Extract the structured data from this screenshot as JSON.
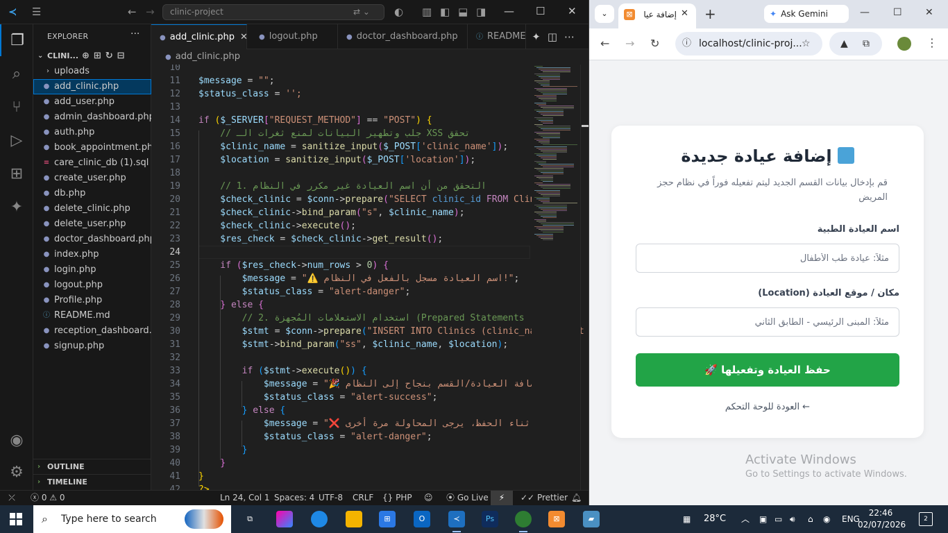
{
  "vscode": {
    "command_center": "clinic-project",
    "explorer_title": "EXPLORER",
    "project_name": "CLINI...",
    "files": [
      {
        "name": "uploads",
        "kind": "folder"
      },
      {
        "name": "add_clinic.php",
        "kind": "php",
        "selected": true
      },
      {
        "name": "add_user.php",
        "kind": "php"
      },
      {
        "name": "admin_dashboard.php",
        "kind": "php"
      },
      {
        "name": "auth.php",
        "kind": "php"
      },
      {
        "name": "book_appointment.php",
        "kind": "php"
      },
      {
        "name": "care_clinic_db (1).sql",
        "kind": "db"
      },
      {
        "name": "create_user.php",
        "kind": "php"
      },
      {
        "name": "db.php",
        "kind": "php"
      },
      {
        "name": "delete_clinic.php",
        "kind": "php"
      },
      {
        "name": "delete_user.php",
        "kind": "php"
      },
      {
        "name": "doctor_dashboard.php",
        "kind": "php"
      },
      {
        "name": "index.php",
        "kind": "php"
      },
      {
        "name": "login.php",
        "kind": "php"
      },
      {
        "name": "logout.php",
        "kind": "php"
      },
      {
        "name": "Profile.php",
        "kind": "php"
      },
      {
        "name": "README.md",
        "kind": "md"
      },
      {
        "name": "reception_dashboard....",
        "kind": "php"
      },
      {
        "name": "signup.php",
        "kind": "php"
      }
    ],
    "outline_label": "OUTLINE",
    "timeline_label": "TIMELINE",
    "tabs": [
      {
        "label": "add_clinic.php",
        "active": true
      },
      {
        "label": "logout.php",
        "active": false
      },
      {
        "label": "doctor_dashboard.php",
        "active": false
      },
      {
        "label": "README",
        "active": false
      }
    ],
    "breadcrumb": "add_clinic.php",
    "line_numbers": [
      "10",
      "11",
      "12",
      "13",
      "14",
      "15",
      "16",
      "17",
      "18",
      "19",
      "20",
      "21",
      "22",
      "23",
      "24",
      "25",
      "26",
      "27",
      "28",
      "29",
      "30",
      "31",
      "32",
      "33",
      "34",
      "35",
      "36",
      "37",
      "38",
      "39",
      "40",
      "41",
      "42"
    ],
    "current_line": "24",
    "code_lines": [
      [],
      [
        [
          "v",
          "$message"
        ],
        [
          "p",
          " = "
        ],
        [
          "s",
          "\"\""
        ],
        [
          "p",
          ";"
        ]
      ],
      [
        [
          "v",
          "$status_class"
        ],
        [
          "p",
          " = "
        ],
        [
          "s",
          "'';"
        ]
      ],
      [],
      [
        [
          "k",
          "if "
        ],
        [
          "b1",
          "("
        ],
        [
          "v",
          "$_SERVER"
        ],
        [
          "b2",
          "["
        ],
        [
          "s",
          "\"REQUEST_METHOD\""
        ],
        [
          "b2",
          "]"
        ],
        [
          "p",
          " == "
        ],
        [
          "s",
          "\"POST\""
        ],
        [
          "b1",
          ")"
        ],
        [
          "p",
          " "
        ],
        [
          "b1",
          "{"
        ]
      ],
      [
        [
          "c",
          "    // جلب وتطهير البيانات لمنع ثغرات الـ XSS تحقق"
        ]
      ],
      [
        [
          "v",
          "    $clinic_name"
        ],
        [
          "p",
          " = "
        ],
        [
          "f",
          "sanitize_input"
        ],
        [
          "b2",
          "("
        ],
        [
          "v",
          "$_POST"
        ],
        [
          "b3",
          "["
        ],
        [
          "s",
          "'clinic_name'"
        ],
        [
          "b3",
          "]"
        ],
        [
          "b2",
          ")"
        ],
        [
          "p",
          ";"
        ]
      ],
      [
        [
          "v",
          "    $location"
        ],
        [
          "p",
          " = "
        ],
        [
          "f",
          "sanitize_input"
        ],
        [
          "b2",
          "("
        ],
        [
          "v",
          "$_POST"
        ],
        [
          "b3",
          "["
        ],
        [
          "s",
          "'location'"
        ],
        [
          "b3",
          "]"
        ],
        [
          "b2",
          ")"
        ],
        [
          "p",
          ";"
        ]
      ],
      [],
      [
        [
          "c",
          "    // 1. التحقق من أن اسم العيادة غير مكرر في النظام"
        ]
      ],
      [
        [
          "v",
          "    $check_clinic"
        ],
        [
          "p",
          " = "
        ],
        [
          "v",
          "$conn"
        ],
        [
          "p",
          "->"
        ],
        [
          "f",
          "prepare"
        ],
        [
          "b2",
          "("
        ],
        [
          "s",
          "\"SELECT "
        ],
        [
          "kw",
          "clinic_id "
        ],
        [
          "k",
          "FROM "
        ],
        [
          "s",
          "Clin"
        ]
      ],
      [
        [
          "v",
          "    $check_clinic"
        ],
        [
          "p",
          "->"
        ],
        [
          "f",
          "bind_param"
        ],
        [
          "b2",
          "("
        ],
        [
          "s",
          "\"s\""
        ],
        [
          "p",
          ", "
        ],
        [
          "v",
          "$clinic_name"
        ],
        [
          "b2",
          ")"
        ],
        [
          "p",
          ";"
        ]
      ],
      [
        [
          "v",
          "    $check_clinic"
        ],
        [
          "p",
          "->"
        ],
        [
          "f",
          "execute"
        ],
        [
          "b2",
          "()"
        ],
        [
          "p",
          ";"
        ]
      ],
      [
        [
          "v",
          "    $res_check"
        ],
        [
          "p",
          " = "
        ],
        [
          "v",
          "$check_clinic"
        ],
        [
          "p",
          "->"
        ],
        [
          "f",
          "get_result"
        ],
        [
          "b2",
          "()"
        ],
        [
          "p",
          ";"
        ]
      ],
      [],
      [
        [
          "k",
          "    if "
        ],
        [
          "b2",
          "("
        ],
        [
          "v",
          "$res_check"
        ],
        [
          "p",
          "->"
        ],
        [
          "v",
          "num_rows"
        ],
        [
          "p",
          " > "
        ],
        [
          "n",
          "0"
        ],
        [
          "b2",
          ")"
        ],
        [
          "p",
          " "
        ],
        [
          "b2",
          "{"
        ]
      ],
      [
        [
          "v",
          "        $message"
        ],
        [
          "p",
          " = "
        ],
        [
          "s",
          "\"⚠️ اسم العيادة مسجل بالفعل في النظام!\""
        ],
        [
          "p",
          ";"
        ]
      ],
      [
        [
          "v",
          "        $status_class"
        ],
        [
          "p",
          " = "
        ],
        [
          "s",
          "\"alert-danger\""
        ],
        [
          "p",
          ";"
        ]
      ],
      [
        [
          "b2",
          "    }"
        ],
        [
          "k",
          " else "
        ],
        [
          "b2",
          "{"
        ]
      ],
      [
        [
          "c",
          "        // 2. استخدام الاستعلامات المُجهزة (Prepared Statements "
        ]
      ],
      [
        [
          "v",
          "        $stmt"
        ],
        [
          "p",
          " = "
        ],
        [
          "v",
          "$conn"
        ],
        [
          "p",
          "->"
        ],
        [
          "f",
          "prepare"
        ],
        [
          "b3",
          "("
        ],
        [
          "s",
          "\"INSERT INTO "
        ],
        [
          "s",
          "Clinics (clinic_name, locat"
        ]
      ],
      [
        [
          "v",
          "        $stmt"
        ],
        [
          "p",
          "->"
        ],
        [
          "f",
          "bind_param"
        ],
        [
          "b3",
          "("
        ],
        [
          "s",
          "\"ss\""
        ],
        [
          "p",
          ", "
        ],
        [
          "v",
          "$clinic_name"
        ],
        [
          "p",
          ", "
        ],
        [
          "v",
          "$location"
        ],
        [
          "b3",
          ")"
        ],
        [
          "p",
          ";"
        ]
      ],
      [],
      [
        [
          "k",
          "        if "
        ],
        [
          "b3",
          "("
        ],
        [
          "v",
          "$stmt"
        ],
        [
          "p",
          "->"
        ],
        [
          "f",
          "execute"
        ],
        [
          "b1",
          "()"
        ],
        [
          "b3",
          ")"
        ],
        [
          "p",
          " "
        ],
        [
          "b3",
          "{"
        ]
      ],
      [
        [
          "v",
          "            $message"
        ],
        [
          "p",
          " = "
        ],
        [
          "s",
          "\"🎉 تم إضافة العيادة/القسم بنجاح إلى النظام\""
        ]
      ],
      [
        [
          "v",
          "            $status_class"
        ],
        [
          "p",
          " = "
        ],
        [
          "s",
          "\"alert-success\""
        ],
        [
          "p",
          ";"
        ]
      ],
      [
        [
          "b3",
          "        }"
        ],
        [
          "k",
          " else "
        ],
        [
          "b3",
          "{"
        ]
      ],
      [
        [
          "v",
          "            $message"
        ],
        [
          "p",
          " = "
        ],
        [
          "s",
          "\"❌ خطأ أثناء الحفظ، يرجى المحاولة مرة أخرى\""
        ]
      ],
      [
        [
          "v",
          "            $status_class"
        ],
        [
          "p",
          " = "
        ],
        [
          "s",
          "\"alert-danger\""
        ],
        [
          "p",
          ";"
        ]
      ],
      [
        [
          "b3",
          "        }"
        ]
      ],
      [
        [
          "b2",
          "    }"
        ]
      ],
      [
        [
          "b1",
          "}"
        ]
      ],
      [
        [
          "b1",
          "?>"
        ]
      ]
    ],
    "status": {
      "errors": "0",
      "warnings": "0",
      "position": "Ln 24, Col 1",
      "spaces": "Spaces: 4",
      "encoding": "UTF-8",
      "eol": "CRLF",
      "language": "PHP",
      "golive": "Go Live",
      "prettier": "Prettier"
    }
  },
  "chrome": {
    "tab_title": "إضافة عيا",
    "gemini_label": "Ask Gemini",
    "url": "localhost/clinic-proj...",
    "page": {
      "title": "إضافة عيادة جديدة",
      "subtitle": "قم بإدخال بيانات القسم الجديد ليتم تفعيله فوراً في نظام حجز المريض",
      "name_label": "اسم العيادة الطبية",
      "name_placeholder": "مثلاً: عيادة طب الأطفال",
      "location_label": "مكان / موقع العيادة (Location)",
      "location_placeholder": "مثلاً: المبنى الرئيسي - الطابق الثاني",
      "submit_label": "حفظ العيادة وتفعيلها 🚀",
      "back_link": "← العودة للوحة التحكم"
    },
    "activate_title": "Activate Windows",
    "activate_sub": "Go to Settings to activate Windows."
  },
  "taskbar": {
    "search_placeholder": "Type here to search",
    "temperature": "28°C",
    "language": "ENG",
    "time": "22:46",
    "date": "02/07/2026",
    "notifications": "2"
  },
  "colors": {
    "vscode_accent": "#0078d4",
    "submit_green": "#22a447",
    "taskbar_bg": "#1c2a3a"
  }
}
